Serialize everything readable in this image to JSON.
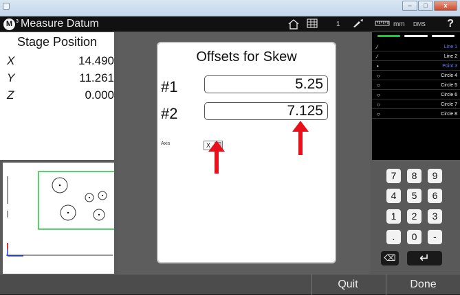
{
  "window": {
    "minimize": "–",
    "maximize": "□",
    "close": "x"
  },
  "header": {
    "logo": "M",
    "logo_sup": "3",
    "title": "Measure Datum",
    "count": "1",
    "unit": "mm",
    "angle": "DMS",
    "help": "?"
  },
  "stage": {
    "title": "Stage Position",
    "axes": [
      {
        "label": "X",
        "value": "14.490"
      },
      {
        "label": "Y",
        "value": "11.261"
      },
      {
        "label": "Z",
        "value": "0.000"
      }
    ]
  },
  "dialog": {
    "title": "Offsets for Skew",
    "fields": [
      {
        "label": "#1",
        "value": "5.25"
      },
      {
        "label": "#2",
        "value": "7.125"
      }
    ],
    "axis_label": "Axis",
    "axis_value": "X"
  },
  "features": [
    {
      "icon": "line-icon",
      "glyph": "∕",
      "name": "Line 1"
    },
    {
      "icon": "line-icon",
      "glyph": "∕",
      "name": "Line 2"
    },
    {
      "icon": "point-icon",
      "glyph": "•",
      "name": "Point 3"
    },
    {
      "icon": "circle-icon",
      "glyph": "○",
      "name": "Circle 4"
    },
    {
      "icon": "circle-icon",
      "glyph": "○",
      "name": "Circle 5"
    },
    {
      "icon": "circle-icon",
      "glyph": "○",
      "name": "Circle 6"
    },
    {
      "icon": "circle-icon",
      "glyph": "○",
      "name": "Circle 7"
    },
    {
      "icon": "circle-icon",
      "glyph": "○",
      "name": "Circle 8"
    }
  ],
  "keypad": {
    "keys": [
      "7",
      "8",
      "9",
      "4",
      "5",
      "6",
      "1",
      "2",
      "3",
      ".",
      "0",
      "-"
    ],
    "backspace": "⌫",
    "enter": "↵"
  },
  "footer": {
    "quit": "Quit",
    "done": "Done"
  },
  "colors": {
    "accent_green": "#21c43a",
    "selected_blue": "#6a7cff",
    "annotation_red": "#e8101b"
  }
}
